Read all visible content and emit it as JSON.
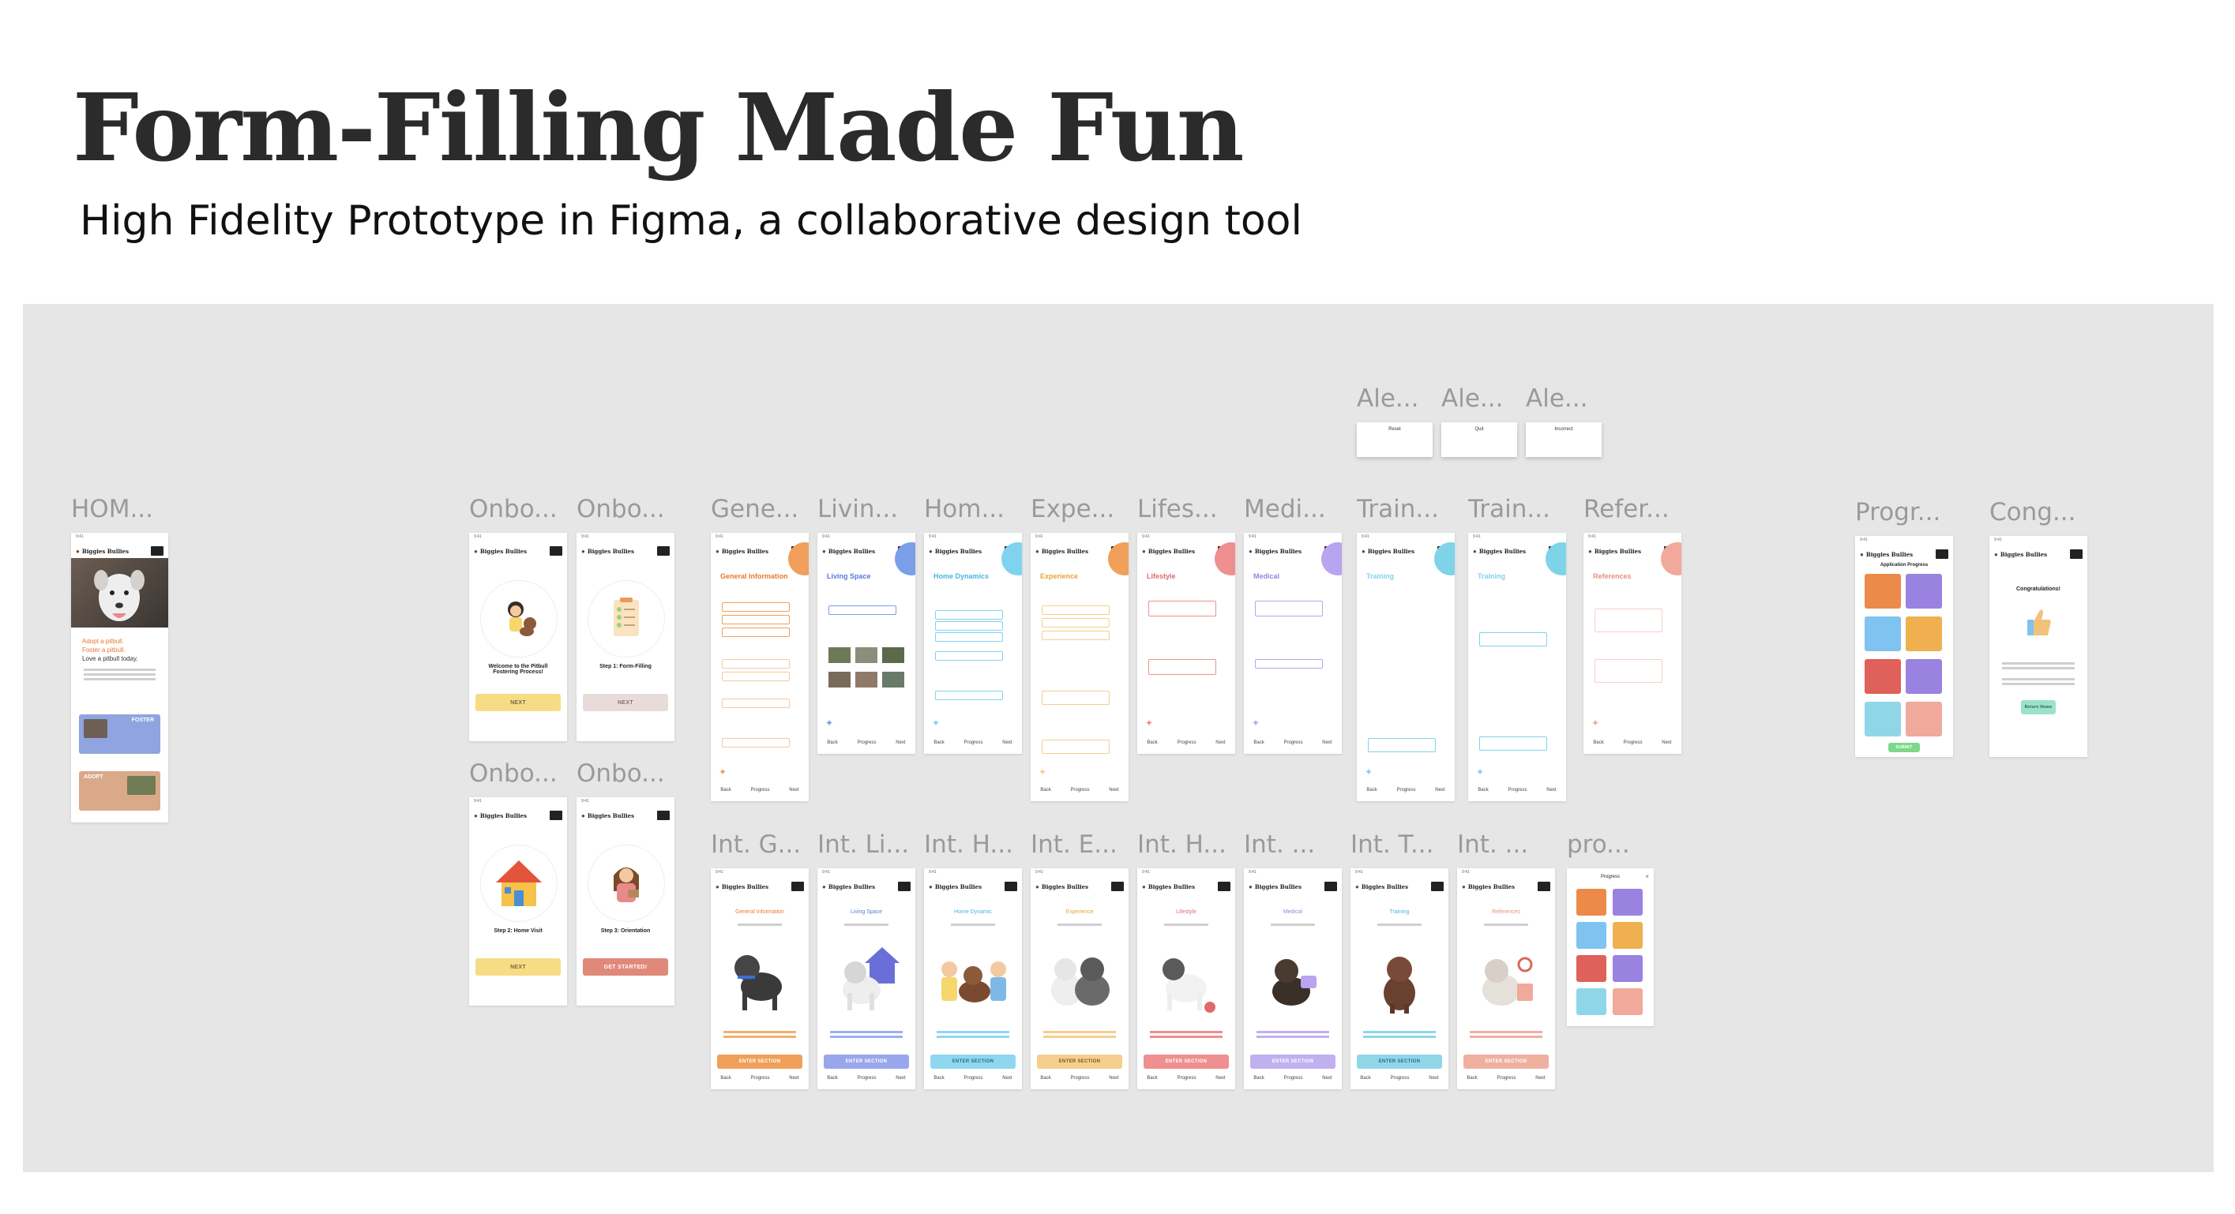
{
  "header": {
    "title": "Form-Filling Made Fun",
    "subtitle": "High Fidelity Prototype in Figma, a collaborative design tool"
  },
  "brand": "Biggies Bullies",
  "status_time": "9:41",
  "nav": {
    "prev": "Back",
    "progress": "Progress",
    "next": "Next"
  },
  "colors": {
    "orange": "#f0a05a",
    "blue": "#7b9ee8",
    "cyan": "#7fd3f0",
    "peach": "#f5cf8e",
    "pink": "#ef8f8f",
    "purple": "#b8a4ef",
    "teal": "#7fd3e8",
    "salmon": "#f0a99b",
    "yellow": "#f7dc86",
    "rose": "#e59c8c",
    "green": "#9be3a8"
  },
  "frames": {
    "home": {
      "label": "HOM...",
      "lines": [
        "Adopt a pitbull.",
        "Foster a pitbull.",
        "Love a pitbull today."
      ],
      "foster_label": "FOSTER",
      "adopt_label": "ADOPT"
    },
    "onboarding": [
      {
        "label": "Onbo...",
        "title": "Welcome to the Pitbull Fostering Process!",
        "button": "NEXT"
      },
      {
        "label": "Onbo...",
        "title": "Step 1: Form-Filling",
        "button": "NEXT"
      },
      {
        "label": "Onbo...",
        "title": "Step 2: Home Visit",
        "button": "NEXT"
      },
      {
        "label": "Onbo...",
        "title": "Step 3: Orientation",
        "button": "GET STARTED!"
      }
    ],
    "sections": [
      {
        "label": "Gene...",
        "title": "General Information"
      },
      {
        "label": "Livin...",
        "title": "Living Space"
      },
      {
        "label": "Hom...",
        "title": "Home Dynamics"
      },
      {
        "label": "Expe...",
        "title": "Experience"
      },
      {
        "label": "Lifes...",
        "title": "Lifestyle"
      },
      {
        "label": "Medi...",
        "title": "Medical"
      },
      {
        "label": "Train...",
        "title": "Training"
      },
      {
        "label": "Train...",
        "title": "Training"
      },
      {
        "label": "Refer...",
        "title": "References"
      }
    ],
    "alerts": [
      {
        "label": "Ale...",
        "title": "Reset"
      },
      {
        "label": "Ale...",
        "title": "Quit"
      },
      {
        "label": "Ale...",
        "title": "Incorrect"
      }
    ],
    "progress": {
      "label": "Progr...",
      "title": "Application Progress",
      "button": "SUBMIT"
    },
    "congrats": {
      "label": "Cong...",
      "title": "Congratulations!",
      "button": "Return Home"
    },
    "intros": [
      {
        "label": "Int. G...",
        "title": "General Information",
        "button": "ENTER SECTION"
      },
      {
        "label": "Int. Li...",
        "title": "Living Space",
        "button": "ENTER SECTION"
      },
      {
        "label": "Int. H...",
        "title": "Home Dynamic",
        "button": "ENTER SECTION"
      },
      {
        "label": "Int. E...",
        "title": "Experience",
        "button": "ENTER SECTION"
      },
      {
        "label": "Int. H...",
        "title": "Lifestyle",
        "button": "ENTER SECTION"
      },
      {
        "label": "Int. ...",
        "title": "Medical",
        "button": "ENTER SECTION"
      },
      {
        "label": "Int. T...",
        "title": "Training",
        "button": "ENTER SECTION"
      },
      {
        "label": "Int. ...",
        "title": "References",
        "button": "ENTER SECTION"
      }
    ],
    "progress_popup": {
      "label": "pro...",
      "title": "Progress"
    }
  }
}
